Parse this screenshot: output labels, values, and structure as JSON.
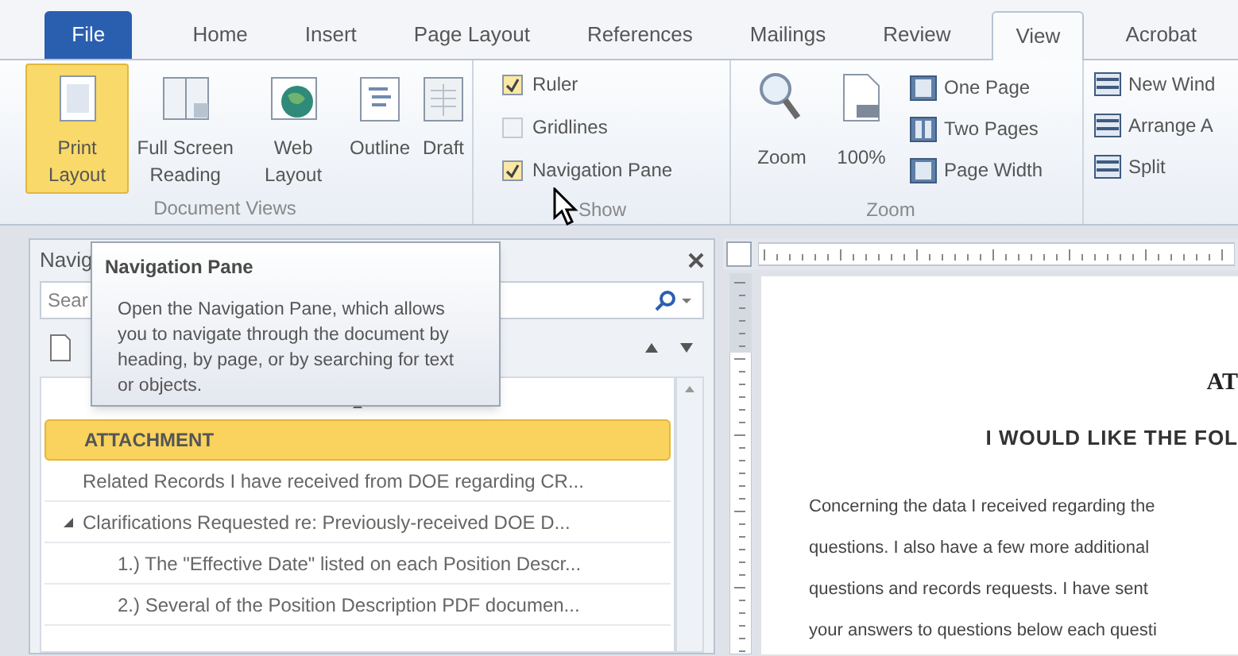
{
  "ribbon_tabs": [
    {
      "label": "File",
      "kind": "file",
      "selected": false
    },
    {
      "label": "Home",
      "kind": "tab",
      "selected": false
    },
    {
      "label": "Insert",
      "kind": "tab",
      "selected": false
    },
    {
      "label": "Page Layout",
      "kind": "tab",
      "selected": false
    },
    {
      "label": "References",
      "kind": "tab",
      "selected": false
    },
    {
      "label": "Mailings",
      "kind": "tab",
      "selected": false
    },
    {
      "label": "Review",
      "kind": "tab",
      "selected": false
    },
    {
      "label": "View",
      "kind": "tab",
      "selected": true
    },
    {
      "label": "Acrobat",
      "kind": "tab",
      "selected": false
    }
  ],
  "document_views": {
    "label": "Document Views",
    "buttons": [
      {
        "label": "Print Layout",
        "selected": true
      },
      {
        "label": "Full Screen Reading",
        "selected": false
      },
      {
        "label": "Web Layout",
        "selected": false
      },
      {
        "label": "Outline",
        "selected": false
      },
      {
        "label": "Draft",
        "selected": false
      }
    ]
  },
  "show": {
    "label": "Show",
    "options": [
      {
        "label": "Ruler",
        "checked": true
      },
      {
        "label": "Gridlines",
        "checked": false
      },
      {
        "label": "Navigation Pane",
        "checked": true
      }
    ]
  },
  "zoom": {
    "label": "Zoom",
    "large": [
      "Zoom",
      "100%"
    ],
    "small": [
      "One Page",
      "Two Pages",
      "Page Width"
    ]
  },
  "window_group": {
    "buttons": [
      "New Wind",
      "Arrange A",
      "Split"
    ]
  },
  "tooltip": {
    "title": "Navigation Pane",
    "text": "Open the Navigation Pane, which allows you to navigate through the document by heading, by page, or by searching for text or objects."
  },
  "navigation_pane": {
    "title": "Navig",
    "search": {
      "placeholder": "Sear"
    },
    "items": [
      {
        "text": "ATTACHMENT",
        "selected": true
      },
      {
        "text": "Related Records I have received from DOE regarding CR...",
        "selected": false
      },
      {
        "text": "Clarifications Requested re: Previously-received DOE D...",
        "selected": false,
        "children": [
          {
            "text": "1.) The \"Effective Date\" listed on each Position Descr...",
            "selected": false
          },
          {
            "text": "2.) Several of the Position Description PDF documen...",
            "selected": false
          }
        ]
      }
    ]
  },
  "document": {
    "title": "AT",
    "heading": "I WOULD LIKE THE FOL",
    "lines": [
      "Concerning the data I received regarding the",
      "questions.  I also have a few more additional",
      "questions and records requests.  I have sent",
      "your answers to questions below each questi"
    ]
  }
}
